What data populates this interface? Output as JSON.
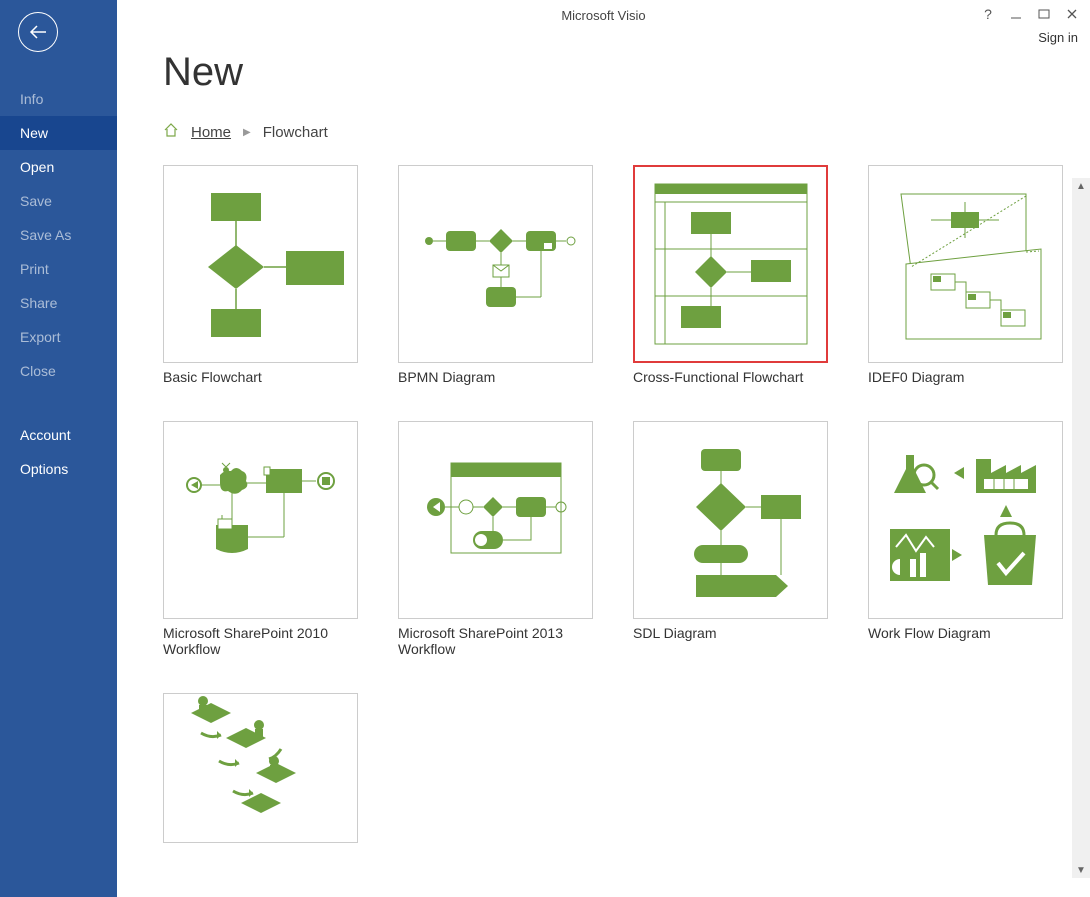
{
  "app_title": "Microsoft Visio",
  "signin": "Sign in",
  "page_heading": "New",
  "breadcrumb": {
    "home": "Home",
    "current": "Flowchart"
  },
  "sidebar": {
    "items": [
      {
        "label": "Info",
        "disabled": true
      },
      {
        "label": "New",
        "selected": true
      },
      {
        "label": "Open"
      },
      {
        "label": "Save",
        "disabled": true
      },
      {
        "label": "Save As",
        "disabled": true
      },
      {
        "label": "Print",
        "disabled": true
      },
      {
        "label": "Share",
        "disabled": true
      },
      {
        "label": "Export",
        "disabled": true
      },
      {
        "label": "Close",
        "disabled": true
      }
    ],
    "secondary": [
      {
        "label": "Account"
      },
      {
        "label": "Options"
      }
    ]
  },
  "templates": [
    {
      "id": "basic-flowchart",
      "label": "Basic Flowchart"
    },
    {
      "id": "bpmn-diagram",
      "label": "BPMN Diagram"
    },
    {
      "id": "cross-functional-flowchart",
      "label": "Cross-Functional Flowchart",
      "highlighted": true
    },
    {
      "id": "idef0-diagram",
      "label": "IDEF0 Diagram"
    },
    {
      "id": "sharepoint-2010-workflow",
      "label": "Microsoft SharePoint 2010 Workflow"
    },
    {
      "id": "sharepoint-2013-workflow",
      "label": "Microsoft SharePoint 2013 Workflow"
    },
    {
      "id": "sdl-diagram",
      "label": "SDL Diagram"
    },
    {
      "id": "work-flow-diagram",
      "label": "Work Flow Diagram"
    },
    {
      "id": "isometric-workflow",
      "label": ""
    }
  ],
  "colors": {
    "accent": "#2b579a",
    "green": "#6ea040"
  }
}
